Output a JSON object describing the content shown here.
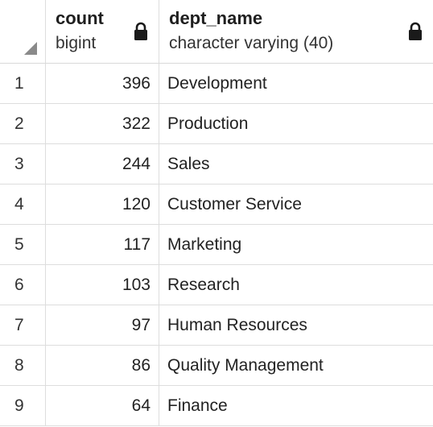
{
  "columns": [
    {
      "name": "count",
      "type": "bigint"
    },
    {
      "name": "dept_name",
      "type": "character varying (40)"
    }
  ],
  "rows": [
    {
      "num": "1",
      "count": "396",
      "dept_name": "Development"
    },
    {
      "num": "2",
      "count": "322",
      "dept_name": "Production"
    },
    {
      "num": "3",
      "count": "244",
      "dept_name": "Sales"
    },
    {
      "num": "4",
      "count": "120",
      "dept_name": "Customer Service"
    },
    {
      "num": "5",
      "count": "117",
      "dept_name": "Marketing"
    },
    {
      "num": "6",
      "count": "103",
      "dept_name": "Research"
    },
    {
      "num": "7",
      "count": "97",
      "dept_name": "Human Resources"
    },
    {
      "num": "8",
      "count": "86",
      "dept_name": "Quality Management"
    },
    {
      "num": "9",
      "count": "64",
      "dept_name": "Finance"
    }
  ],
  "icons": {
    "lock": "lock-icon",
    "corner": "select-all-corner-icon"
  },
  "colors": {
    "gridline": "#dddddd",
    "text": "#222222",
    "corner": "#8a8a8a"
  }
}
